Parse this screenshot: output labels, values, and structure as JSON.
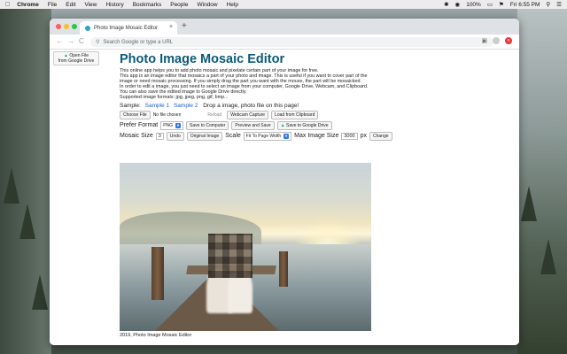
{
  "menubar": {
    "apple": "",
    "items": [
      "Chrome",
      "File",
      "Edit",
      "View",
      "History",
      "Bookmarks",
      "People",
      "Window",
      "Help"
    ],
    "battery": "100%",
    "time": "Fri 6:55 PM"
  },
  "browser": {
    "tab_title": "Photo Image Mosaic Editor",
    "new_tab": "+",
    "tab_close": "×",
    "back": "←",
    "forward": "→",
    "reload": "C",
    "omnibox_placeholder": "Search Google or type a URL"
  },
  "page": {
    "drive_button_line1": "Open File",
    "drive_button_line2": "from Google Drive",
    "title": "Photo Image Mosaic Editor",
    "description": [
      "This online app helps you to add photo mosaic and pixelate certain part of your image for free.",
      "This app is an image editor that mosaics a part of your photo and image. This is useful if you want to cover part of the",
      "image or need mosaic processing. If you simply drag the part you want with the mouse, the part will be mosaicked.",
      "In order to edit a image, you just need to select an image from your computer, Google Drive, Webcam, and Clipboard.",
      "You can also save the edited image to Google Drive directly.",
      "Supported image formats: jpg, jpeg, png, gif, bmp..."
    ],
    "sample_label": "Sample:",
    "sample1": "Sample 1",
    "sample2": "Sample 2",
    "drop_text": "Drop a image, photo file on this page!",
    "choose_file": "Choose File",
    "no_file": "No file chosen",
    "reload_btn": "Reload",
    "webcam_btn": "Webcam Capture",
    "clipboard_btn": "Load from Clipboard",
    "prefer_format_label": "Prefer Format",
    "format_value": "PNG",
    "save_computer": "Save to Computer",
    "preview_save": "Preview and Save",
    "save_drive": "Save to Google Drive",
    "mosaic_size_label": "Mosaic Size",
    "mosaic_size_value": "3",
    "undo_btn": "Undo",
    "original_btn": "Original Image",
    "scale_label": "Scale",
    "scale_value": "Fit To Page Width",
    "max_size_label": "Max Image Size",
    "max_size_value": "3000",
    "px_label": "px",
    "change_btn": "Change",
    "footer": "2019, Photo Image Mosaic Editor"
  },
  "colors": {
    "title": "#0b5a7a",
    "link": "#1a5fd0",
    "traffic_red": "#fe5f57",
    "traffic_yellow": "#febc2e",
    "traffic_green": "#28c840"
  }
}
